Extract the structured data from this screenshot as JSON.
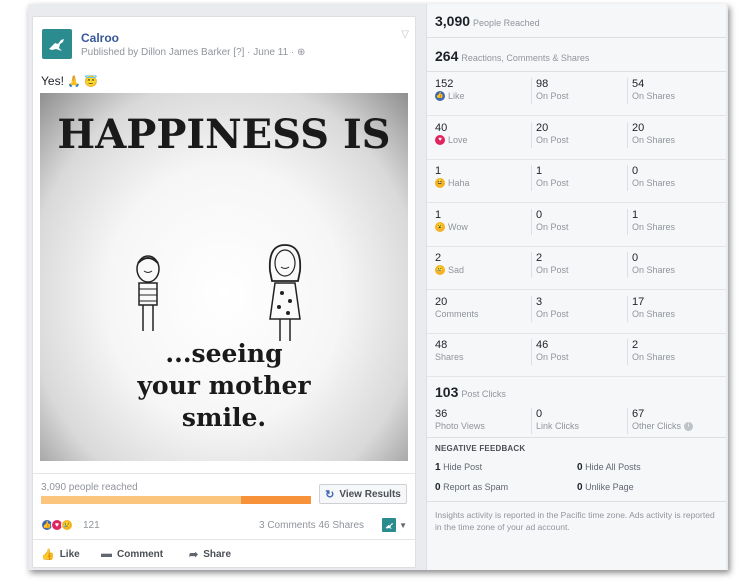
{
  "post": {
    "page_name": "Calroo",
    "published_line": "Published by Dillon James Barker [?] · June 11 · ",
    "text": "Yes!",
    "text_emojis": [
      "folded-hands-emoji",
      "smiling-face-with-halo-emoji"
    ],
    "image": {
      "title": "HAPPINESS IS",
      "caption_lines": [
        "...seeing",
        "your mother",
        "smile."
      ]
    },
    "reach_text": "3,090 people reached",
    "reach_organic_fraction": 0.74,
    "view_results_label": "View Results",
    "reaction_count": "121",
    "comments_label": "3 Comments",
    "shares_label": "46 Shares",
    "actions": {
      "like": "Like",
      "comment": "Comment",
      "share": "Share"
    }
  },
  "insights": {
    "reached": {
      "value": "3,090",
      "label": "People Reached"
    },
    "engagement": {
      "value": "264",
      "label": "Reactions, Comments & Shares"
    },
    "rows": [
      {
        "total": "152",
        "label": "Like",
        "icon": "like-reaction-icon",
        "on_post": "98",
        "on_shares": "54"
      },
      {
        "total": "40",
        "label": "Love",
        "icon": "love-reaction-icon",
        "on_post": "20",
        "on_shares": "20"
      },
      {
        "total": "1",
        "label": "Haha",
        "icon": "haha-reaction-icon",
        "on_post": "1",
        "on_shares": "0"
      },
      {
        "total": "1",
        "label": "Wow",
        "icon": "wow-reaction-icon",
        "on_post": "0",
        "on_shares": "1"
      },
      {
        "total": "2",
        "label": "Sad",
        "icon": "sad-reaction-icon",
        "on_post": "2",
        "on_shares": "0"
      },
      {
        "total": "20",
        "label": "Comments",
        "icon": "",
        "on_post": "3",
        "on_shares": "17"
      },
      {
        "total": "48",
        "label": "Shares",
        "icon": "",
        "on_post": "46",
        "on_shares": "2"
      }
    ],
    "on_post_label": "On Post",
    "on_shares_label": "On Shares",
    "clicks": {
      "value": "103",
      "label": "Post Clicks",
      "photo_views": "36",
      "photo_views_label": "Photo Views",
      "link_clicks": "0",
      "link_clicks_label": "Link Clicks",
      "other_clicks": "67",
      "other_clicks_label": "Other Clicks"
    },
    "negative": {
      "title": "NEGATIVE FEEDBACK",
      "hide_post": "1",
      "hide_post_label": "Hide Post",
      "hide_all": "0",
      "hide_all_label": "Hide All Posts",
      "spam": "0",
      "spam_label": "Report as Spam",
      "unlike": "0",
      "unlike_label": "Unlike Page"
    },
    "footnote": "Insights activity is reported in the Pacific time zone. Ads activity is reported in the time zone of your ad account."
  },
  "colors": {
    "brand": "#2a8c8e",
    "link": "#365899",
    "reach_paid": "#f7923a",
    "reach_organic": "#fbc57d",
    "like": "#4267b2",
    "love": "#e0245e",
    "haha": "#f7b125"
  }
}
